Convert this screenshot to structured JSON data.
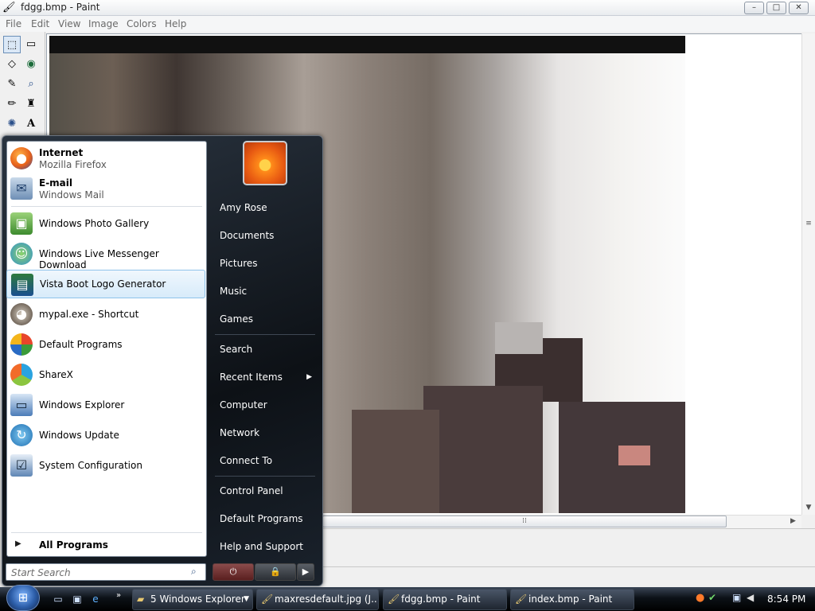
{
  "window": {
    "title": "fdgg.bmp - Paint",
    "minimize": "–",
    "maximize": "□",
    "close": "✕"
  },
  "menubar": [
    "File",
    "Edit",
    "View",
    "Image",
    "Colors",
    "Help"
  ],
  "start_menu": {
    "pinned": [
      {
        "title": "Internet",
        "subtitle": "Mozilla Firefox",
        "icon": "firefox-icon"
      },
      {
        "title": "E-mail",
        "subtitle": "Windows Mail",
        "icon": "mail-icon"
      }
    ],
    "recent": [
      {
        "label": "Windows Photo Gallery",
        "icon": "photo-gallery-icon"
      },
      {
        "label": "Windows Live Messenger Download",
        "icon": "messenger-icon"
      },
      {
        "label": "Vista Boot Logo Generator",
        "icon": "boot-logo-icon"
      },
      {
        "label": "mypal.exe - Shortcut",
        "icon": "mypal-icon"
      },
      {
        "label": "Default Programs",
        "icon": "default-programs-icon"
      },
      {
        "label": "ShareX",
        "icon": "sharex-icon"
      },
      {
        "label": "Windows Explorer",
        "icon": "explorer-icon"
      },
      {
        "label": "Windows Update",
        "icon": "update-icon"
      },
      {
        "label": "System Configuration",
        "icon": "sysconfig-icon"
      }
    ],
    "all_programs": "All Programs",
    "search_placeholder": "Start Search",
    "right": {
      "user": "Amy Rose",
      "documents": "Documents",
      "pictures": "Pictures",
      "music": "Music",
      "games": "Games",
      "search": "Search",
      "recent_items": "Recent Items",
      "computer": "Computer",
      "network": "Network",
      "connect_to": "Connect To",
      "control_panel": "Control Panel",
      "default_programs": "Default Programs",
      "help": "Help and Support"
    }
  },
  "taskbar": {
    "buttons": [
      {
        "label": "5  Windows Explorer"
      },
      {
        "label": "maxresdefault.jpg (J..."
      },
      {
        "label": "fdgg.bmp - Paint"
      },
      {
        "label": "index.bmp - Paint"
      }
    ],
    "clock": "8:54 PM"
  }
}
